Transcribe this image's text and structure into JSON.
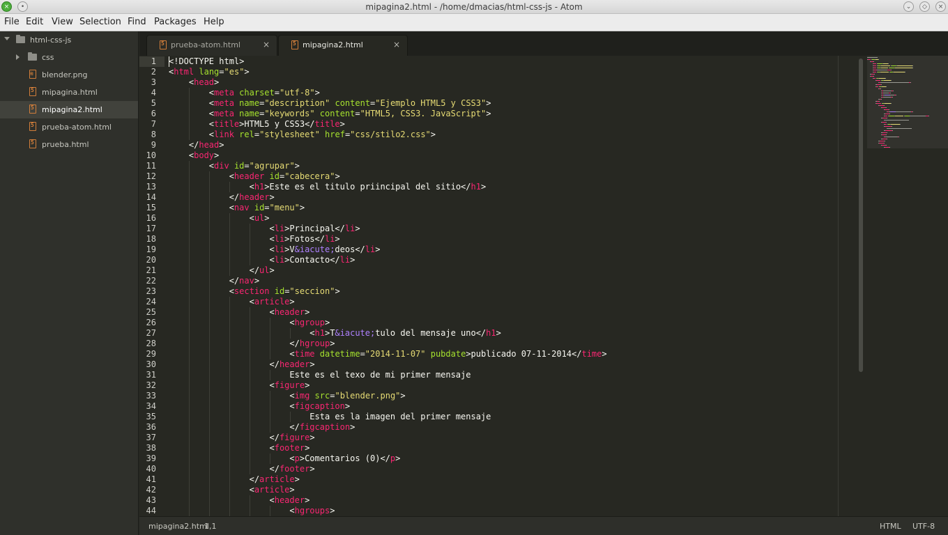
{
  "window": {
    "title": "mipagina2.html - /home/dmacias/html-css-js - Atom",
    "controls": {
      "close": "×",
      "menu": "•",
      "minimize": "⌄",
      "maximize": "◇",
      "exit": "×"
    }
  },
  "menu": [
    "File",
    "Edit",
    "View",
    "Selection",
    "Find",
    "Packages",
    "Help"
  ],
  "tree": {
    "root": "html-css-js",
    "items": [
      {
        "label": "css",
        "kind": "folder"
      },
      {
        "label": "blender.png",
        "kind": "image"
      },
      {
        "label": "mipagina.html",
        "kind": "html"
      },
      {
        "label": "mipagina2.html",
        "kind": "html",
        "selected": true
      },
      {
        "label": "prueba-atom.html",
        "kind": "html"
      },
      {
        "label": "prueba.html",
        "kind": "html"
      }
    ]
  },
  "tabs": [
    {
      "label": "prueba-atom.html",
      "active": false,
      "close": "×"
    },
    {
      "label": "mipagina2.html",
      "active": true,
      "close": "×"
    }
  ],
  "editor": {
    "line_numbers": [
      "1",
      "2",
      "3",
      "4",
      "5",
      "6",
      "7",
      "8",
      "9",
      "10",
      "11",
      "12",
      "13",
      "14",
      "15",
      "16",
      "17",
      "18",
      "19",
      "20",
      "21",
      "22",
      "23",
      "24",
      "25",
      "26",
      "27",
      "28",
      "29",
      "30",
      "31",
      "32",
      "33",
      "34",
      "35",
      "36",
      "37",
      "38",
      "39",
      "40",
      "41",
      "42",
      "43",
      "44"
    ],
    "lines": [
      [
        [
          "p",
          "<!DOCTYPE html>"
        ]
      ],
      [
        [
          "p",
          "<"
        ],
        [
          "tag",
          "html"
        ],
        [
          "p",
          " "
        ],
        [
          "attr",
          "lang"
        ],
        [
          "p",
          "="
        ],
        [
          "str",
          "\"es\""
        ],
        [
          "p",
          ">"
        ]
      ],
      [
        [
          "p",
          "    <"
        ],
        [
          "tag",
          "head"
        ],
        [
          "p",
          ">"
        ]
      ],
      [
        [
          "p",
          "        <"
        ],
        [
          "tag",
          "meta"
        ],
        [
          "p",
          " "
        ],
        [
          "attr",
          "charset"
        ],
        [
          "p",
          "="
        ],
        [
          "str",
          "\"utf-8\""
        ],
        [
          "p",
          ">"
        ]
      ],
      [
        [
          "p",
          "        <"
        ],
        [
          "tag",
          "meta"
        ],
        [
          "p",
          " "
        ],
        [
          "attr",
          "name"
        ],
        [
          "p",
          "="
        ],
        [
          "str",
          "\"description\""
        ],
        [
          "p",
          " "
        ],
        [
          "attr",
          "content"
        ],
        [
          "p",
          "="
        ],
        [
          "str",
          "\"Ejemplo HTML5 y CSS3\""
        ],
        [
          "p",
          ">"
        ]
      ],
      [
        [
          "p",
          "        <"
        ],
        [
          "tag",
          "meta"
        ],
        [
          "p",
          " "
        ],
        [
          "attr",
          "name"
        ],
        [
          "p",
          "="
        ],
        [
          "str",
          "\"keywords\""
        ],
        [
          "p",
          " "
        ],
        [
          "attr",
          "content"
        ],
        [
          "p",
          "="
        ],
        [
          "str",
          "\"HTML5, CSS3. JavaScript\""
        ],
        [
          "p",
          ">"
        ]
      ],
      [
        [
          "p",
          "        <"
        ],
        [
          "tag",
          "title"
        ],
        [
          "p",
          ">HTML5 y CSS3</"
        ],
        [
          "tag",
          "title"
        ],
        [
          "p",
          ">"
        ]
      ],
      [
        [
          "p",
          "        <"
        ],
        [
          "tag",
          "link"
        ],
        [
          "p",
          " "
        ],
        [
          "attr",
          "rel"
        ],
        [
          "p",
          "="
        ],
        [
          "str",
          "\"stylesheet\""
        ],
        [
          "p",
          " "
        ],
        [
          "attr",
          "href"
        ],
        [
          "p",
          "="
        ],
        [
          "str",
          "\"css/stilo2.css\""
        ],
        [
          "p",
          ">"
        ]
      ],
      [
        [
          "p",
          "    </"
        ],
        [
          "tag",
          "head"
        ],
        [
          "p",
          ">"
        ]
      ],
      [
        [
          "p",
          "    <"
        ],
        [
          "tag",
          "body"
        ],
        [
          "p",
          ">"
        ]
      ],
      [
        [
          "p",
          "        <"
        ],
        [
          "tag",
          "div"
        ],
        [
          "p",
          " "
        ],
        [
          "attr",
          "id"
        ],
        [
          "p",
          "="
        ],
        [
          "str",
          "\"agrupar\""
        ],
        [
          "p",
          ">"
        ]
      ],
      [
        [
          "p",
          "            <"
        ],
        [
          "tag",
          "header"
        ],
        [
          "p",
          " "
        ],
        [
          "attr",
          "id"
        ],
        [
          "p",
          "="
        ],
        [
          "str",
          "\"cabecera\""
        ],
        [
          "p",
          ">"
        ]
      ],
      [
        [
          "p",
          "                <"
        ],
        [
          "tag",
          "h1"
        ],
        [
          "p",
          ">Este es el titulo priincipal del sitio</"
        ],
        [
          "tag",
          "h1"
        ],
        [
          "p",
          ">"
        ]
      ],
      [
        [
          "p",
          "            </"
        ],
        [
          "tag",
          "header"
        ],
        [
          "p",
          ">"
        ]
      ],
      [
        [
          "p",
          "            <"
        ],
        [
          "tag",
          "nav"
        ],
        [
          "p",
          " "
        ],
        [
          "attr",
          "id"
        ],
        [
          "p",
          "="
        ],
        [
          "str",
          "\"menu\""
        ],
        [
          "p",
          ">"
        ]
      ],
      [
        [
          "p",
          "                <"
        ],
        [
          "tag",
          "ul"
        ],
        [
          "p",
          ">"
        ]
      ],
      [
        [
          "p",
          "                    <"
        ],
        [
          "tag",
          "li"
        ],
        [
          "p",
          ">Principal</"
        ],
        [
          "tag",
          "li"
        ],
        [
          "p",
          ">"
        ]
      ],
      [
        [
          "p",
          "                    <"
        ],
        [
          "tag",
          "li"
        ],
        [
          "p",
          ">Fotos</"
        ],
        [
          "tag",
          "li"
        ],
        [
          "p",
          ">"
        ]
      ],
      [
        [
          "p",
          "                    <"
        ],
        [
          "tag",
          "li"
        ],
        [
          "p",
          ">V"
        ],
        [
          "ent",
          "&iacute;"
        ],
        [
          "p",
          "deos</"
        ],
        [
          "tag",
          "li"
        ],
        [
          "p",
          ">"
        ]
      ],
      [
        [
          "p",
          "                    <"
        ],
        [
          "tag",
          "li"
        ],
        [
          "p",
          ">Contacto</"
        ],
        [
          "tag",
          "li"
        ],
        [
          "p",
          ">"
        ]
      ],
      [
        [
          "p",
          "                </"
        ],
        [
          "tag",
          "ul"
        ],
        [
          "p",
          ">"
        ]
      ],
      [
        [
          "p",
          "            </"
        ],
        [
          "tag",
          "nav"
        ],
        [
          "p",
          ">"
        ]
      ],
      [
        [
          "p",
          "            <"
        ],
        [
          "tag",
          "section"
        ],
        [
          "p",
          " "
        ],
        [
          "attr",
          "id"
        ],
        [
          "p",
          "="
        ],
        [
          "str",
          "\"seccion\""
        ],
        [
          "p",
          ">"
        ]
      ],
      [
        [
          "p",
          "                <"
        ],
        [
          "tag",
          "article"
        ],
        [
          "p",
          ">"
        ]
      ],
      [
        [
          "p",
          "                    <"
        ],
        [
          "tag",
          "header"
        ],
        [
          "p",
          ">"
        ]
      ],
      [
        [
          "p",
          "                        <"
        ],
        [
          "tag",
          "hgroup"
        ],
        [
          "p",
          ">"
        ]
      ],
      [
        [
          "p",
          "                            <"
        ],
        [
          "tag",
          "h1"
        ],
        [
          "p",
          ">T"
        ],
        [
          "ent",
          "&iacute;"
        ],
        [
          "p",
          "tulo del mensaje uno</"
        ],
        [
          "tag",
          "h1"
        ],
        [
          "p",
          ">"
        ]
      ],
      [
        [
          "p",
          "                        </"
        ],
        [
          "tag",
          "hgroup"
        ],
        [
          "p",
          ">"
        ]
      ],
      [
        [
          "p",
          "                        <"
        ],
        [
          "tag",
          "time"
        ],
        [
          "p",
          " "
        ],
        [
          "attr",
          "datetime"
        ],
        [
          "p",
          "="
        ],
        [
          "str",
          "\"2014-11-07\""
        ],
        [
          "p",
          " "
        ],
        [
          "attr",
          "pubdate"
        ],
        [
          "p",
          ">publicado 07-11-2014</"
        ],
        [
          "tag",
          "time"
        ],
        [
          "p",
          ">"
        ]
      ],
      [
        [
          "p",
          "                    </"
        ],
        [
          "tag",
          "header"
        ],
        [
          "p",
          ">"
        ]
      ],
      [
        [
          "p",
          "                        Este es el texo de mi primer mensaje"
        ]
      ],
      [
        [
          "p",
          "                    <"
        ],
        [
          "tag",
          "figure"
        ],
        [
          "p",
          ">"
        ]
      ],
      [
        [
          "p",
          "                        <"
        ],
        [
          "tag",
          "img"
        ],
        [
          "p",
          " "
        ],
        [
          "attr",
          "src"
        ],
        [
          "p",
          "="
        ],
        [
          "str",
          "\"blender.png\""
        ],
        [
          "p",
          ">"
        ]
      ],
      [
        [
          "p",
          "                        <"
        ],
        [
          "tag",
          "figcaption"
        ],
        [
          "p",
          ">"
        ]
      ],
      [
        [
          "p",
          "                            Esta es la imagen del primer mensaje"
        ]
      ],
      [
        [
          "p",
          "                        </"
        ],
        [
          "tag",
          "figcaption"
        ],
        [
          "p",
          ">"
        ]
      ],
      [
        [
          "p",
          "                    </"
        ],
        [
          "tag",
          "figure"
        ],
        [
          "p",
          ">"
        ]
      ],
      [
        [
          "p",
          "                    <"
        ],
        [
          "tag",
          "footer"
        ],
        [
          "p",
          ">"
        ]
      ],
      [
        [
          "p",
          "                        <"
        ],
        [
          "tag",
          "p"
        ],
        [
          "p",
          ">Comentarios (0)</"
        ],
        [
          "tag",
          "p"
        ],
        [
          "p",
          ">"
        ]
      ],
      [
        [
          "p",
          "                    </"
        ],
        [
          "tag",
          "footer"
        ],
        [
          "p",
          ">"
        ]
      ],
      [
        [
          "p",
          "                </"
        ],
        [
          "tag",
          "article"
        ],
        [
          "p",
          ">"
        ]
      ],
      [
        [
          "p",
          "                <"
        ],
        [
          "tag",
          "article"
        ],
        [
          "p",
          ">"
        ]
      ],
      [
        [
          "p",
          "                    <"
        ],
        [
          "tag",
          "header"
        ],
        [
          "p",
          ">"
        ]
      ],
      [
        [
          "p",
          "                        <"
        ],
        [
          "tag",
          "hgroups"
        ],
        [
          "p",
          ">"
        ]
      ]
    ]
  },
  "status": {
    "file": "mipagina2.html",
    "cursor": "1,1",
    "grammar": "HTML",
    "encoding": "UTF-8"
  }
}
